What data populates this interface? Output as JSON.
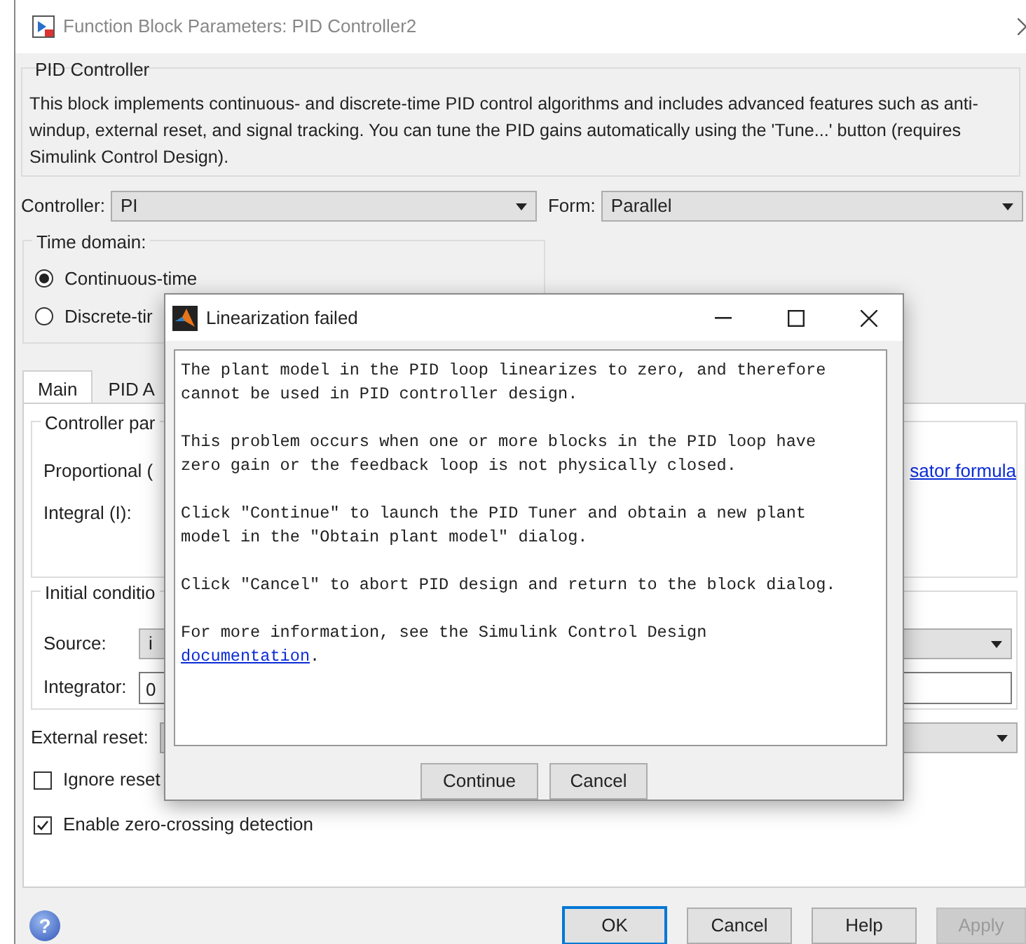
{
  "window": {
    "title": "Function Block Parameters: PID Controller2"
  },
  "block": {
    "heading": "PID Controller",
    "description": "This block implements continuous- and discrete-time PID control algorithms and includes advanced features such as anti-windup, external reset, and signal tracking. You can tune the PID gains automatically using the 'Tune...' button (requires Simulink Control Design)."
  },
  "controller": {
    "label": "Controller:",
    "value": "PI"
  },
  "form": {
    "label": "Form:",
    "value": "Parallel"
  },
  "time_domain": {
    "heading": "Time domain:",
    "options": [
      {
        "label": "Continuous-time",
        "selected": true
      },
      {
        "label": "Discrete-tir",
        "selected": false
      }
    ]
  },
  "tabs": [
    {
      "label": "Main",
      "selected": true
    },
    {
      "label": "PID A",
      "selected": false
    }
  ],
  "controller_parameters": {
    "heading": "Controller par",
    "rows": [
      {
        "label": "Proportional ("
      },
      {
        "label": "Integral (I):"
      }
    ],
    "link": "sator formula"
  },
  "initial_conditions": {
    "heading": "Initial conditio",
    "source": {
      "label": "Source:",
      "value": "i"
    },
    "integrator": {
      "label": "Integrator:",
      "value": "0"
    }
  },
  "external_reset": {
    "label": "External reset:"
  },
  "checkboxes": [
    {
      "label": "Ignore reset",
      "checked": false
    },
    {
      "label": "Enable zero-crossing detection",
      "checked": true
    }
  ],
  "help": {
    "glyph": "?"
  },
  "buttons": [
    {
      "label": "OK",
      "focused": true,
      "disabled": false
    },
    {
      "label": "Cancel",
      "focused": false,
      "disabled": false
    },
    {
      "label": "Help",
      "focused": false,
      "disabled": false
    },
    {
      "label": "Apply",
      "focused": false,
      "disabled": true
    }
  ],
  "alert": {
    "title": "Linearization failed",
    "paragraphs": [
      "The plant model in the PID loop linearizes to zero, and therefore\ncannot be used in PID controller design.",
      "This problem occurs when one or more blocks in the PID loop have\nzero gain or the feedback loop is not physically closed.",
      "Click \"Continue\" to launch the PID Tuner and obtain a new plant\nmodel in the \"Obtain plant model\" dialog.",
      "Click \"Cancel\" to abort PID design and return to the block dialog.",
      "For more information, see the Simulink Control Design\n"
    ],
    "link": "documentation",
    "link_after": ".",
    "buttons": [
      {
        "label": "Continue"
      },
      {
        "label": "Cancel"
      }
    ]
  }
}
